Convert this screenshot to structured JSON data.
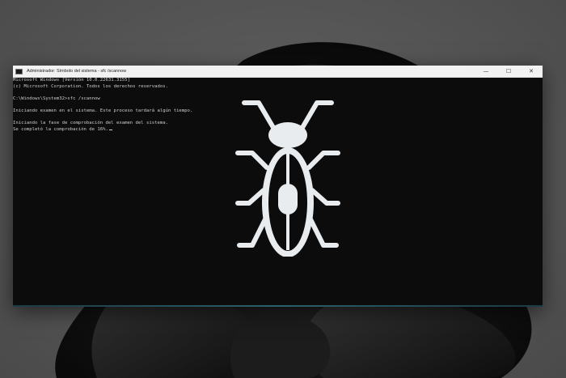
{
  "window": {
    "title": "Administrador: Símbolo del sistema - sfc  /scannow",
    "controls": {
      "minimize": "—",
      "maximize": "☐",
      "close": "✕"
    }
  },
  "console": {
    "lines": [
      "Microsoft Windows [Versión 10.0.22631.3155]",
      "(c) Microsoft Corporation. Todos los derechos reservados.",
      "",
      "C:\\Windows\\System32>sfc /scannow",
      "",
      "Iniciando examen en el sistema. Este proceso tardará algún tiempo.",
      "",
      "Iniciando la fase de comprobación del examen del sistema.",
      "Se completó la comprobación de 16%."
    ]
  },
  "colors": {
    "console_background": "#0c0c0c",
    "console_text": "#cccccc",
    "titlebar": "#f2f2f2",
    "bug_icon": "#e8ecef"
  },
  "icons": {
    "app": "terminal-icon",
    "overlay": "bug-icon"
  }
}
